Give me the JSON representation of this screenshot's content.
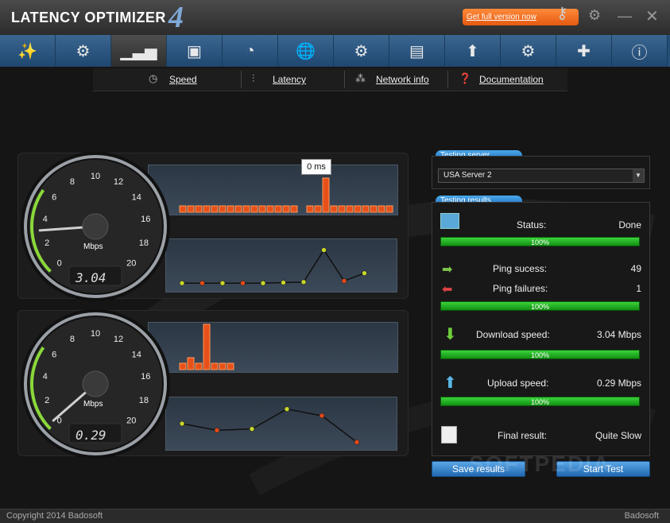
{
  "window": {
    "title": "LATENCY OPTIMIZER",
    "version": "4",
    "get_full_label": "Get full version now",
    "icons": [
      "key-icon",
      "gear-icon",
      "minimize-icon",
      "close-icon"
    ]
  },
  "toolbar": {
    "items": [
      {
        "name": "wand-icon",
        "glyph": "✨"
      },
      {
        "name": "settings-list-icon",
        "glyph": "⚙"
      },
      {
        "name": "chart-icon",
        "glyph": "▁▃▅"
      },
      {
        "name": "chip-icon",
        "glyph": "▣"
      },
      {
        "name": "speedometer-icon",
        "glyph": "◔"
      },
      {
        "name": "globe-icon",
        "glyph": "🌐"
      },
      {
        "name": "network-icon",
        "glyph": "⚙"
      },
      {
        "name": "notes-icon",
        "glyph": "▤"
      },
      {
        "name": "upload-icon",
        "glyph": "⬆"
      },
      {
        "name": "gears-icon",
        "glyph": "⚙"
      },
      {
        "name": "shield-icon",
        "glyph": "✚"
      },
      {
        "name": "info-icon",
        "glyph": "ⓘ"
      }
    ],
    "active_index": 2
  },
  "subnav": {
    "speed": "Speed",
    "latency": "Latency",
    "network_info": "Network info",
    "documentation": "Documentation"
  },
  "gauges": [
    {
      "unit": "Mbps",
      "readout": "3.04",
      "ticks": [
        "0",
        "2",
        "4",
        "6",
        "8",
        "10",
        "12",
        "14",
        "16",
        "18",
        "20"
      ],
      "value": 3.04
    },
    {
      "unit": "Mbps",
      "readout": "0.29",
      "ticks": [
        "0",
        "2",
        "4",
        "6",
        "8",
        "10",
        "12",
        "14",
        "16",
        "18",
        "20"
      ],
      "value": 0.29
    }
  ],
  "charts": {
    "tooltip": "0 ms"
  },
  "chart_data": [
    {
      "type": "bar",
      "name": "download-latency-bars",
      "values": [
        1,
        1,
        1,
        1,
        1,
        1,
        1,
        1,
        1,
        1,
        1,
        1,
        1,
        1,
        1,
        0,
        1,
        1,
        6,
        1,
        1,
        1,
        1,
        1,
        1,
        1,
        1
      ]
    },
    {
      "type": "line",
      "name": "download-speed-line",
      "values": [
        0.2,
        0.2,
        0.2,
        0.2,
        0.2,
        0.25,
        0.3,
        3.2,
        0.4,
        1.1
      ],
      "colors": [
        "y",
        "r",
        "y",
        "r",
        "y",
        "y",
        "y",
        "y",
        "r",
        "y"
      ]
    },
    {
      "type": "bar",
      "name": "upload-latency-bars",
      "values": [
        1,
        2,
        1,
        8,
        1,
        1,
        1
      ]
    },
    {
      "type": "line",
      "name": "upload-speed-line",
      "values": [
        1.5,
        1.0,
        1.1,
        2.6,
        2.1,
        0.1
      ],
      "colors": [
        "y",
        "r",
        "y",
        "y",
        "r",
        "r"
      ]
    }
  ],
  "testing_server": {
    "caption": "Testing server",
    "selected": "USA Server 2"
  },
  "testing_results": {
    "caption": "Testing results",
    "status_label": "Status:",
    "status_value": "Done",
    "status_progress": "100%",
    "ping_success_label": "Ping sucess:",
    "ping_success_value": "49",
    "ping_failures_label": "Ping failures:",
    "ping_failures_value": "1",
    "ping_progress": "100%",
    "download_label": "Download speed:",
    "download_value": "3.04 Mbps",
    "download_progress": "100%",
    "upload_label": "Upload speed:",
    "upload_value": "0.29 Mbps",
    "upload_progress": "100%",
    "final_label": "Final result:",
    "final_value": "Quite Slow"
  },
  "buttons": {
    "save": "Save results",
    "start": "Start Test"
  },
  "footer": {
    "copyright": "Copyright 2014 Badosoft",
    "brand": "Badosoft"
  },
  "watermark": "SOFTPEDIA"
}
